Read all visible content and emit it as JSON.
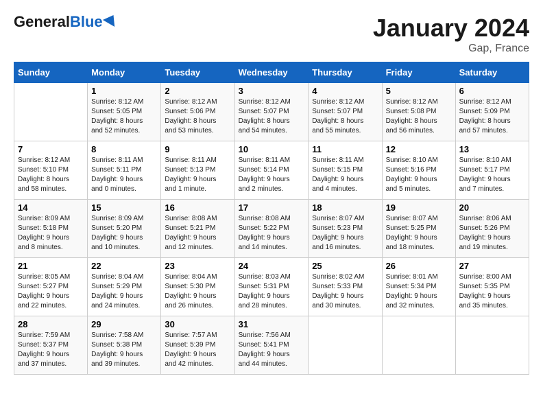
{
  "header": {
    "logo_general": "General",
    "logo_blue": "Blue",
    "month": "January 2024",
    "location": "Gap, France"
  },
  "days_of_week": [
    "Sunday",
    "Monday",
    "Tuesday",
    "Wednesday",
    "Thursday",
    "Friday",
    "Saturday"
  ],
  "weeks": [
    [
      {
        "num": "",
        "info": ""
      },
      {
        "num": "1",
        "info": "Sunrise: 8:12 AM\nSunset: 5:05 PM\nDaylight: 8 hours\nand 52 minutes."
      },
      {
        "num": "2",
        "info": "Sunrise: 8:12 AM\nSunset: 5:06 PM\nDaylight: 8 hours\nand 53 minutes."
      },
      {
        "num": "3",
        "info": "Sunrise: 8:12 AM\nSunset: 5:07 PM\nDaylight: 8 hours\nand 54 minutes."
      },
      {
        "num": "4",
        "info": "Sunrise: 8:12 AM\nSunset: 5:07 PM\nDaylight: 8 hours\nand 55 minutes."
      },
      {
        "num": "5",
        "info": "Sunrise: 8:12 AM\nSunset: 5:08 PM\nDaylight: 8 hours\nand 56 minutes."
      },
      {
        "num": "6",
        "info": "Sunrise: 8:12 AM\nSunset: 5:09 PM\nDaylight: 8 hours\nand 57 minutes."
      }
    ],
    [
      {
        "num": "7",
        "info": "Sunrise: 8:12 AM\nSunset: 5:10 PM\nDaylight: 8 hours\nand 58 minutes."
      },
      {
        "num": "8",
        "info": "Sunrise: 8:11 AM\nSunset: 5:11 PM\nDaylight: 9 hours\nand 0 minutes."
      },
      {
        "num": "9",
        "info": "Sunrise: 8:11 AM\nSunset: 5:13 PM\nDaylight: 9 hours\nand 1 minute."
      },
      {
        "num": "10",
        "info": "Sunrise: 8:11 AM\nSunset: 5:14 PM\nDaylight: 9 hours\nand 2 minutes."
      },
      {
        "num": "11",
        "info": "Sunrise: 8:11 AM\nSunset: 5:15 PM\nDaylight: 9 hours\nand 4 minutes."
      },
      {
        "num": "12",
        "info": "Sunrise: 8:10 AM\nSunset: 5:16 PM\nDaylight: 9 hours\nand 5 minutes."
      },
      {
        "num": "13",
        "info": "Sunrise: 8:10 AM\nSunset: 5:17 PM\nDaylight: 9 hours\nand 7 minutes."
      }
    ],
    [
      {
        "num": "14",
        "info": "Sunrise: 8:09 AM\nSunset: 5:18 PM\nDaylight: 9 hours\nand 8 minutes."
      },
      {
        "num": "15",
        "info": "Sunrise: 8:09 AM\nSunset: 5:20 PM\nDaylight: 9 hours\nand 10 minutes."
      },
      {
        "num": "16",
        "info": "Sunrise: 8:08 AM\nSunset: 5:21 PM\nDaylight: 9 hours\nand 12 minutes."
      },
      {
        "num": "17",
        "info": "Sunrise: 8:08 AM\nSunset: 5:22 PM\nDaylight: 9 hours\nand 14 minutes."
      },
      {
        "num": "18",
        "info": "Sunrise: 8:07 AM\nSunset: 5:23 PM\nDaylight: 9 hours\nand 16 minutes."
      },
      {
        "num": "19",
        "info": "Sunrise: 8:07 AM\nSunset: 5:25 PM\nDaylight: 9 hours\nand 18 minutes."
      },
      {
        "num": "20",
        "info": "Sunrise: 8:06 AM\nSunset: 5:26 PM\nDaylight: 9 hours\nand 19 minutes."
      }
    ],
    [
      {
        "num": "21",
        "info": "Sunrise: 8:05 AM\nSunset: 5:27 PM\nDaylight: 9 hours\nand 22 minutes."
      },
      {
        "num": "22",
        "info": "Sunrise: 8:04 AM\nSunset: 5:29 PM\nDaylight: 9 hours\nand 24 minutes."
      },
      {
        "num": "23",
        "info": "Sunrise: 8:04 AM\nSunset: 5:30 PM\nDaylight: 9 hours\nand 26 minutes."
      },
      {
        "num": "24",
        "info": "Sunrise: 8:03 AM\nSunset: 5:31 PM\nDaylight: 9 hours\nand 28 minutes."
      },
      {
        "num": "25",
        "info": "Sunrise: 8:02 AM\nSunset: 5:33 PM\nDaylight: 9 hours\nand 30 minutes."
      },
      {
        "num": "26",
        "info": "Sunrise: 8:01 AM\nSunset: 5:34 PM\nDaylight: 9 hours\nand 32 minutes."
      },
      {
        "num": "27",
        "info": "Sunrise: 8:00 AM\nSunset: 5:35 PM\nDaylight: 9 hours\nand 35 minutes."
      }
    ],
    [
      {
        "num": "28",
        "info": "Sunrise: 7:59 AM\nSunset: 5:37 PM\nDaylight: 9 hours\nand 37 minutes."
      },
      {
        "num": "29",
        "info": "Sunrise: 7:58 AM\nSunset: 5:38 PM\nDaylight: 9 hours\nand 39 minutes."
      },
      {
        "num": "30",
        "info": "Sunrise: 7:57 AM\nSunset: 5:39 PM\nDaylight: 9 hours\nand 42 minutes."
      },
      {
        "num": "31",
        "info": "Sunrise: 7:56 AM\nSunset: 5:41 PM\nDaylight: 9 hours\nand 44 minutes."
      },
      {
        "num": "",
        "info": ""
      },
      {
        "num": "",
        "info": ""
      },
      {
        "num": "",
        "info": ""
      }
    ]
  ]
}
